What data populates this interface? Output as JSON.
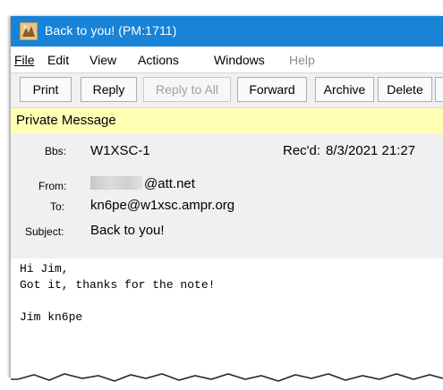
{
  "window": {
    "title": "Back to you!  (PM:1711)"
  },
  "menu": {
    "file": "File",
    "edit": "Edit",
    "view": "View",
    "actions": "Actions",
    "windows": "Windows",
    "help": "Help"
  },
  "toolbar": {
    "print": "Print",
    "reply": "Reply",
    "reply_all": "Reply to All",
    "forward": "Forward",
    "archive": "Archive",
    "delete": "Delete"
  },
  "banner": "Private Message",
  "header": {
    "bbs_label": "Bbs:",
    "bbs_value": "W1XSC-1",
    "recd_label": "Rec'd:",
    "recd_value": "8/3/2021 21:27",
    "from_label": "From:",
    "from_value": "@att.net",
    "to_label": "To:",
    "to_value": "kn6pe@w1xsc.ampr.org",
    "subject_label": "Subject:",
    "subject_value": "Back to you!"
  },
  "body": {
    "lines": [
      "Hi Jim,",
      "Got it, thanks for the note!",
      "",
      "Jim kn6pe"
    ]
  },
  "colors": {
    "titlebar": "#1883d7",
    "banner": "#ffffb4",
    "header_bg": "#f0f0f0"
  }
}
